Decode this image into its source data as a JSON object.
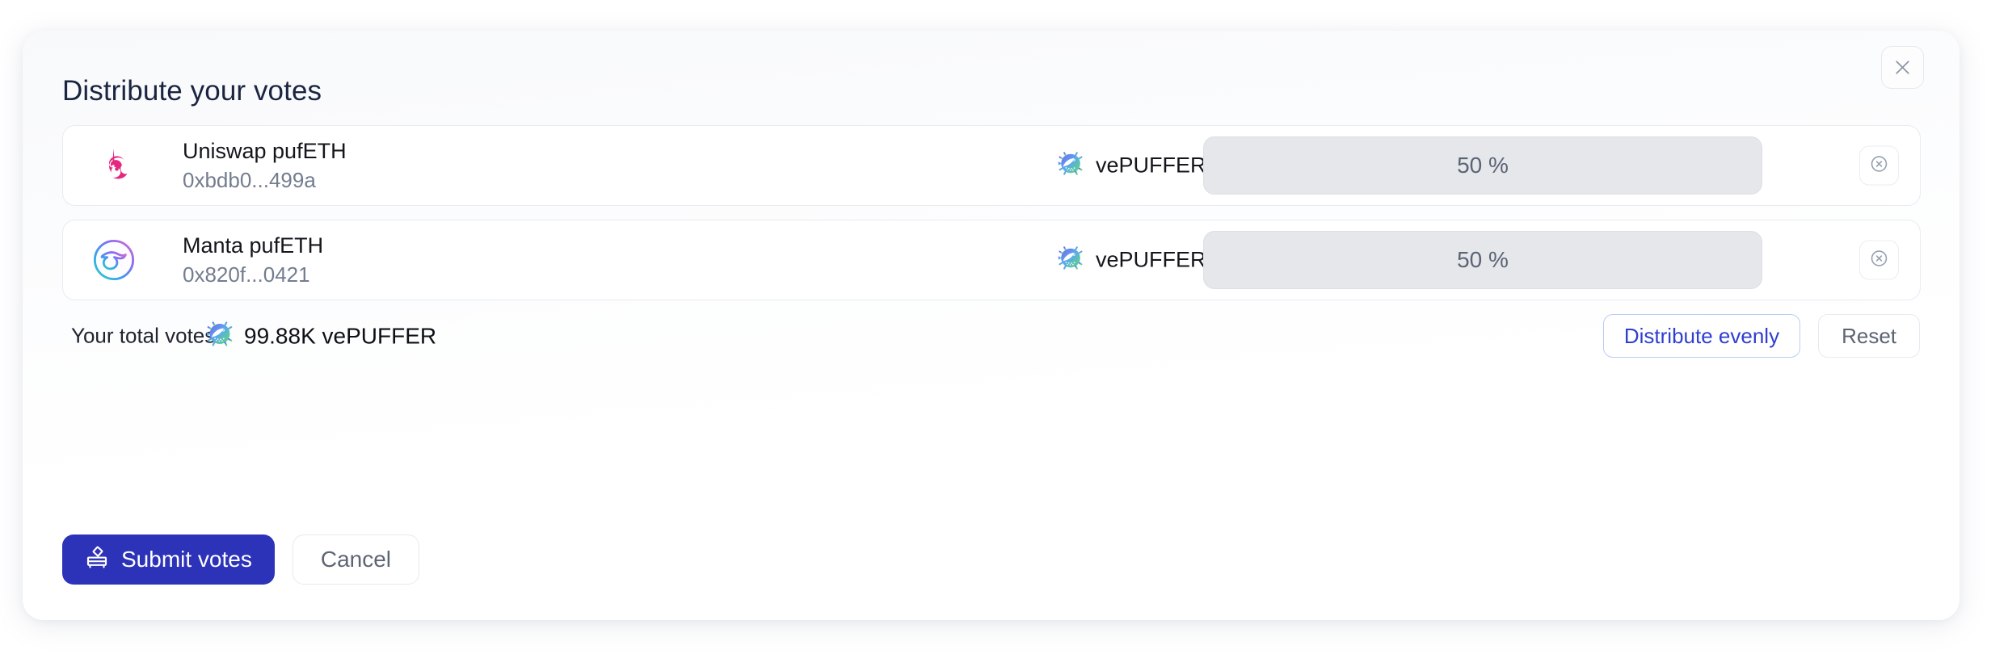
{
  "modal": {
    "title": "Distribute your votes",
    "close_icon": "close-icon"
  },
  "rows": [
    {
      "logo_icon": "uniswap-unicorn-icon",
      "name": "Uniswap pufETH",
      "address": "0xbdb0...499a",
      "token_icon": "vepuffer-icon",
      "token_name": "vePUFFER",
      "percent": "50 %",
      "remove_icon": "circle-x-icon"
    },
    {
      "logo_icon": "manta-icon",
      "name": "Manta pufETH",
      "address": "0x820f...0421",
      "token_icon": "vepuffer-icon",
      "token_name": "vePUFFER",
      "percent": "50 %",
      "remove_icon": "circle-x-icon"
    }
  ],
  "totals": {
    "label": "Your total votes",
    "token_icon": "vepuffer-icon",
    "value": "99.88K vePUFFER",
    "distribute_evenly_label": "Distribute evenly",
    "reset_label": "Reset"
  },
  "footer": {
    "submit_label": "Submit votes",
    "submit_icon": "ballot-box-icon",
    "cancel_label": "Cancel"
  },
  "colors": {
    "accent_blue": "#2d33b8",
    "link_blue": "#2f3fcf",
    "title_navy": "#1b2440",
    "muted_grey": "#737d8f",
    "input_grey": "#e5e7eb"
  }
}
